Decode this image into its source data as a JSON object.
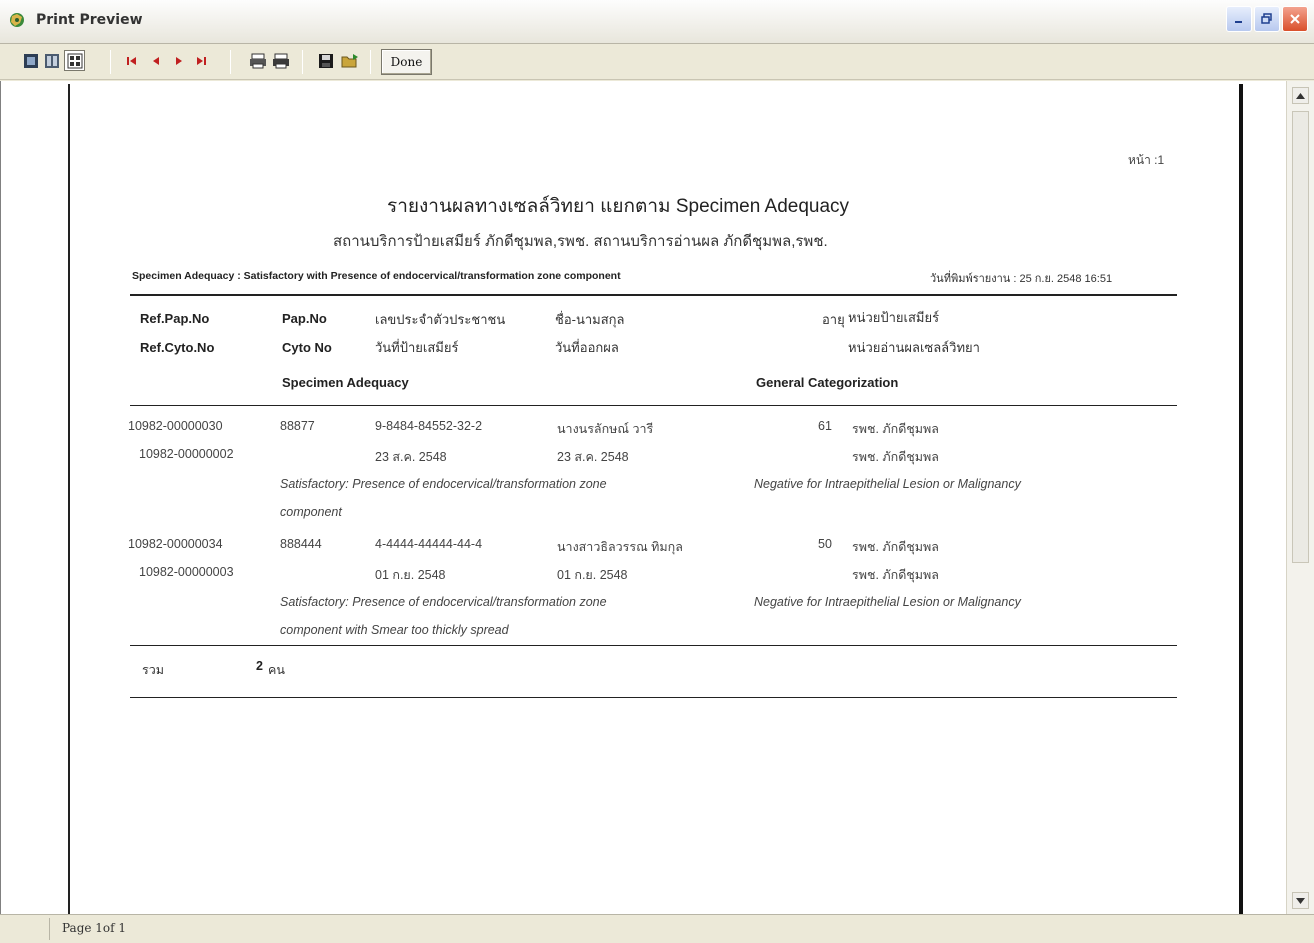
{
  "window": {
    "title": "Print Preview"
  },
  "toolbar": {
    "icons": [
      "single-page-icon",
      "two-page-icon",
      "multi-page-icon",
      "first-page-icon",
      "prev-page-icon",
      "next-page-icon",
      "last-page-icon",
      "print-setup-icon",
      "print-icon",
      "save-icon",
      "open-icon"
    ],
    "done_label": "Done"
  },
  "status": {
    "page": "Page 1of 1"
  },
  "report": {
    "page_label": "หน้า :1",
    "title": "รายงานผลทางเซลล์วิทยา  แยกตาม Specimen Adequacy",
    "subtitle": "สถานบริการป้ายเสมียร์ ภักดีชุมพล,รพช.   สถานบริการอ่านผล ภักดีชุมพล,รพช.",
    "filter": "Specimen Adequacy : Satisfactory with Presence of endocervical/transformation zone component",
    "print_date": "วันที่พิมพ์รายงาน : 25 ก.ย. 2548 16:51",
    "headers": {
      "ref_pap": "Ref.Pap.No",
      "ref_cyto": "Ref.Cyto.No",
      "pap_no": "Pap.No",
      "cyto_no": "Cyto No",
      "id_no": "เลขประจำตัวประชาชน",
      "smear_date": "วันที่ป้ายเสมียร์",
      "name": "ชื่อ-นามสกุล",
      "result_date": "วันที่ออกผล",
      "age": "อายุ",
      "smear_unit": "หน่วยป้ายเสมียร์",
      "read_unit": "หน่วยอ่านผลเซลล์วิทยา",
      "specimen": "Specimen Adequacy",
      "general": "General Categorization"
    },
    "rows": [
      {
        "ref_pap": "10982-00000030",
        "ref_cyto": "10982-00000002",
        "pap_no": "88877",
        "id_no": "9-8484-84552-32-2",
        "smear_date": "23 ส.ค. 2548",
        "name": "นางนรลักษณ์ วารี",
        "result_date": "23 ส.ค. 2548",
        "age": "61",
        "smear_unit": "รพช. ภักดีชุมพล",
        "read_unit": "รพช. ภักดีชุมพล",
        "specimen_line1": "Satisfactory: Presence of endocervical/transformation zone",
        "specimen_line2": "component",
        "general": "Negative for Intraepithelial Lesion or Malignancy"
      },
      {
        "ref_pap": "10982-00000034",
        "ref_cyto": "10982-00000003",
        "pap_no": "888444",
        "id_no": "4-4444-44444-44-4",
        "smear_date": "01 ก.ย. 2548",
        "name": "นางสาวธิลวรรณ ทิมกุล",
        "result_date": "01 ก.ย. 2548",
        "age": "50",
        "smear_unit": "รพช. ภักดีชุมพล",
        "read_unit": "รพช. ภักดีชุมพล",
        "specimen_line1": "Satisfactory: Presence of endocervical/transformation zone",
        "specimen_line2": "component with Smear too thickly spread",
        "general": "Negative for Intraepithelial Lesion or Malignancy"
      }
    ],
    "total_label": "รวม",
    "total_count": "2",
    "total_unit": "คน"
  }
}
